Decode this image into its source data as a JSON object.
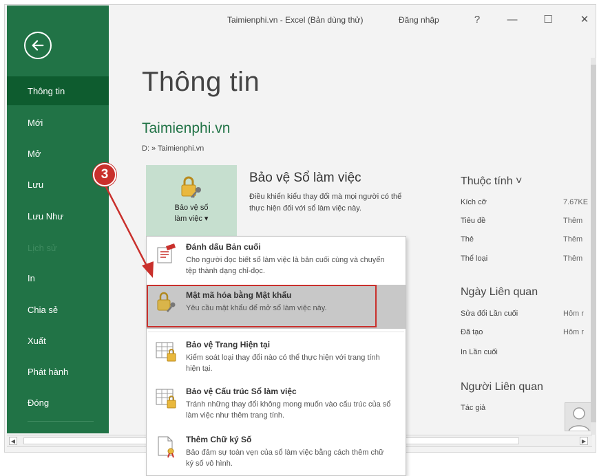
{
  "window": {
    "title": "Taimienphi.vn - Excel (Bản dùng thử)",
    "signin": "Đăng nhập",
    "help": "?",
    "minimize": "—",
    "maximize": "☐",
    "close": "✕"
  },
  "sidebar": {
    "items": [
      {
        "label": "Thông tin",
        "active": true
      },
      {
        "label": "Mới"
      },
      {
        "label": "Mở"
      },
      {
        "label": "Lưu"
      },
      {
        "label": "Lưu Như"
      },
      {
        "label": "Lịch sử",
        "disabled": true
      },
      {
        "label": "In"
      },
      {
        "label": "Chia sẻ"
      },
      {
        "label": "Xuất"
      },
      {
        "label": "Phát hành"
      },
      {
        "label": "Đóng"
      }
    ]
  },
  "main": {
    "page_title": "Thông tin",
    "doc_name": "Taimienphi.vn",
    "doc_path": "D: » Taimienphi.vn",
    "protect": {
      "button_line1": "Bảo vệ sổ",
      "button_line2": "làm việc ▾",
      "heading": "Bảo vệ Sổ làm việc",
      "description": "Điều khiển kiểu thay đổi mà mọi người có thể thực hiện đối với sổ làm việc này."
    }
  },
  "properties": {
    "heading": "Thuộc tính ˅",
    "rows": [
      {
        "key": "Kích cỡ",
        "value": "7.67KE"
      },
      {
        "key": "Tiêu đề",
        "value": "Thêm"
      },
      {
        "key": "Thẻ",
        "value": "Thêm"
      },
      {
        "key": "Thể loại",
        "value": "Thêm"
      }
    ],
    "dates_heading": "Ngày Liên quan",
    "dates": [
      {
        "key": "Sửa đổi Lần cuối",
        "value": "Hôm r"
      },
      {
        "key": "Đã tạo",
        "value": "Hôm r"
      },
      {
        "key": "In Lần cuối",
        "value": ""
      }
    ],
    "people_heading": "Người Liên quan",
    "people": [
      {
        "key": "Tác giả"
      }
    ]
  },
  "menu": {
    "items": [
      {
        "title": "Đánh dấu Bản cuối",
        "desc": "Cho người đọc biết sổ làm việc là bản cuối cùng và chuyển tệp thành dạng chỉ-đọc.",
        "icon": "mark-final-icon"
      },
      {
        "title": "Mật mã hóa bằng Mật khẩu",
        "desc": "Yêu cầu mật khẩu để mở sổ làm việc này.",
        "icon": "lock-key-icon",
        "highlighted": true
      },
      {
        "title": "Bảo vệ Trang Hiện tại",
        "desc": "Kiểm soát loại thay đổi nào có thể thực hiện với trang tính hiện tại.",
        "icon": "protect-sheet-icon"
      },
      {
        "title": "Bảo vệ Cấu trúc Sổ làm việc",
        "desc": "Tránh những thay đổi không mong muốn vào cấu trúc của sổ làm việc như thêm trang tính.",
        "icon": "protect-structure-icon"
      },
      {
        "title": "Thêm Chữ ký Số",
        "desc": "Bảo đảm sự toàn vẹn của sổ làm việc bằng cách thêm chữ ký số vô hình.",
        "icon": "digital-signature-icon"
      }
    ]
  },
  "annotation": {
    "step": "3",
    "color": "#c9302c"
  },
  "colors": {
    "accent": "#217346",
    "sidebar_active": "#0e5c2f",
    "protect_bg": "#c6dfcf",
    "highlight": "#c8c8c8"
  }
}
